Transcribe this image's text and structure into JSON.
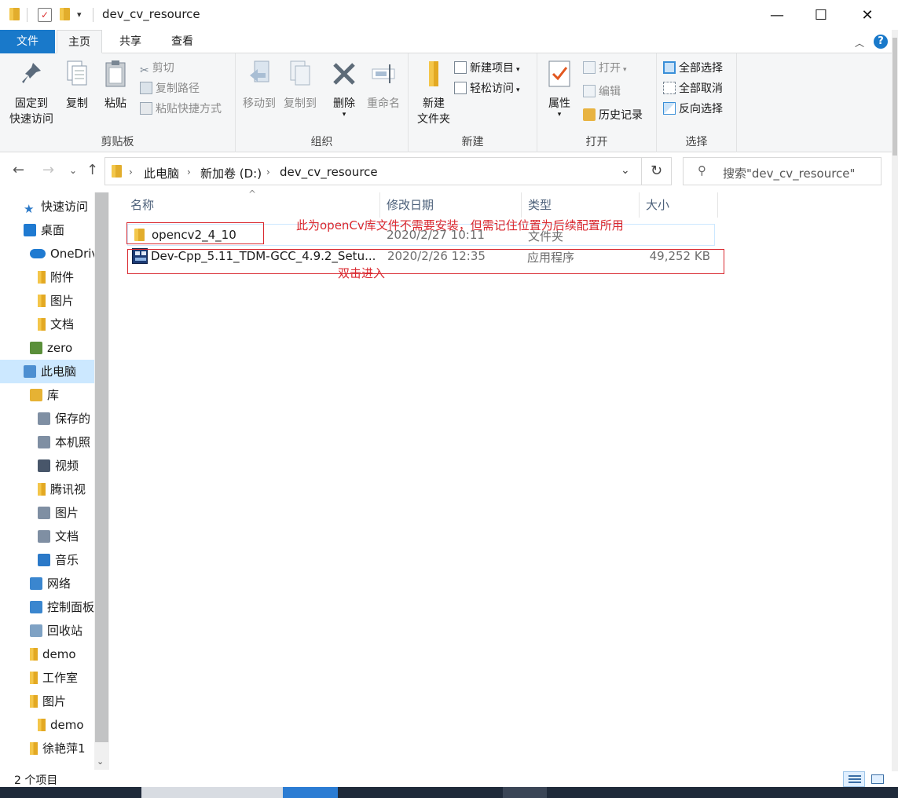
{
  "window": {
    "title": "dev_cv_resource"
  },
  "tabs": [
    {
      "label": "文件"
    },
    {
      "label": "主页"
    },
    {
      "label": "共享"
    },
    {
      "label": "查看"
    }
  ],
  "ribbon": {
    "clipboard": {
      "label": "剪贴板",
      "pin_line1": "固定到",
      "pin_line2": "快速访问",
      "copy": "复制",
      "paste": "粘贴",
      "cut": "剪切",
      "copy_path": "复制路径",
      "paste_shortcut": "粘贴快捷方式"
    },
    "organize": {
      "label": "组织",
      "move_to": "移动到",
      "copy_to": "复制到",
      "delete": "删除",
      "rename": "重命名"
    },
    "new": {
      "label": "新建",
      "new_folder_line1": "新建",
      "new_folder_line2": "文件夹",
      "new_item": "新建项目",
      "easy_access": "轻松访问"
    },
    "open": {
      "label": "打开",
      "properties": "属性",
      "open": "打开",
      "edit": "编辑",
      "history": "历史记录"
    },
    "select": {
      "label": "选择",
      "select_all": "全部选择",
      "select_none": "全部取消",
      "invert": "反向选择"
    }
  },
  "address": {
    "segments": [
      "此电脑",
      "新加卷 (D:)",
      "dev_cv_resource"
    ],
    "search_placeholder": "搜索\"dev_cv_resource\""
  },
  "nav": [
    {
      "label": "快速访问",
      "icon": "star-icon"
    },
    {
      "label": "桌面",
      "icon": "desktop-icon"
    },
    {
      "label": "OneDrive",
      "icon": "cloud-icon"
    },
    {
      "label": "附件",
      "icon": "folder-icon"
    },
    {
      "label": "图片",
      "icon": "folder-icon"
    },
    {
      "label": "文档",
      "icon": "folder-icon"
    },
    {
      "label": "zero",
      "icon": "user-icon"
    },
    {
      "label": "此电脑",
      "icon": "computer-icon"
    },
    {
      "label": "库",
      "icon": "library-icon"
    },
    {
      "label": "保存的",
      "icon": "library-pictures-icon"
    },
    {
      "label": "本机照",
      "icon": "library-pictures-icon"
    },
    {
      "label": "视频",
      "icon": "video-icon"
    },
    {
      "label": "腾讯视",
      "icon": "folder-icon"
    },
    {
      "label": "图片",
      "icon": "library-pictures-icon"
    },
    {
      "label": "文档",
      "icon": "document-icon"
    },
    {
      "label": "音乐",
      "icon": "music-icon"
    },
    {
      "label": "网络",
      "icon": "network-icon"
    },
    {
      "label": "控制面板",
      "icon": "control-panel-icon"
    },
    {
      "label": "回收站",
      "icon": "recycle-bin-icon"
    },
    {
      "label": "demo",
      "icon": "folder-icon"
    },
    {
      "label": "工作室",
      "icon": "folder-icon"
    },
    {
      "label": "图片",
      "icon": "folder-icon"
    },
    {
      "label": "demo",
      "icon": "folder-icon"
    },
    {
      "label": "徐艳萍1",
      "icon": "folder-icon"
    }
  ],
  "columns": {
    "name": "名称",
    "date": "修改日期",
    "type": "类型",
    "size": "大小"
  },
  "files": [
    {
      "name": "opencv2_4_10",
      "date": "2020/2/27 10:11",
      "type": "文件夹",
      "size": ""
    },
    {
      "name": "Dev-Cpp_5.11_TDM-GCC_4.9.2_Setu...",
      "date": "2020/2/26 12:35",
      "type": "应用程序",
      "size": "49,252 KB"
    }
  ],
  "annotations": {
    "opencv_note": "此为openCv库文件不需要安装，但需记住位置为后续配置所用",
    "devcpp_note": "双击进入"
  },
  "status": {
    "item_count": "2 个项目"
  },
  "colors": {
    "accent": "#1979ca",
    "annotation": "#d9282f",
    "selection": "#cce8ff"
  }
}
